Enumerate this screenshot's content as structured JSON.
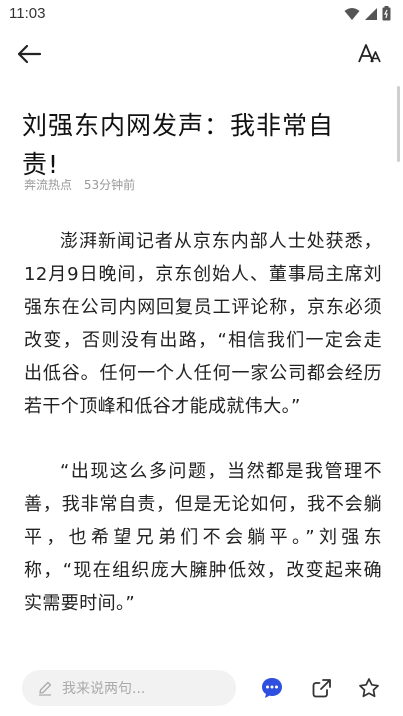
{
  "status_bar": {
    "time": "11:03"
  },
  "toolbar": {
    "back_icon": "arrow-left-icon",
    "font_icon": "font-size-icon"
  },
  "article": {
    "title": "刘强东内网发声：我非常自责!",
    "source": "奔流热点",
    "time_ago": "53分钟前",
    "paragraphs": [
      "澎湃新闻记者从京东内部人士处获悉，12月9日晚间，京东创始人、董事局主席刘强东在公司内网回复员工评论称，京东必须改变，否则没有出路，“相信我们一定会走出低谷。任何一个人任何一家公司都会经历若干个顶峰和低谷才能成就伟大。”",
      "“出现这么多问题，当然都是我管理不善，我非常自责，但是无论如何，我不会躺平，也希望兄弟们不会躺平。”刘强东称，“现在组织庞大臃肿低效，改变起来确实需要时间。”"
    ]
  },
  "bottom_bar": {
    "comment_placeholder": "我来说两句...",
    "accent_color": "#2f4fe0"
  }
}
